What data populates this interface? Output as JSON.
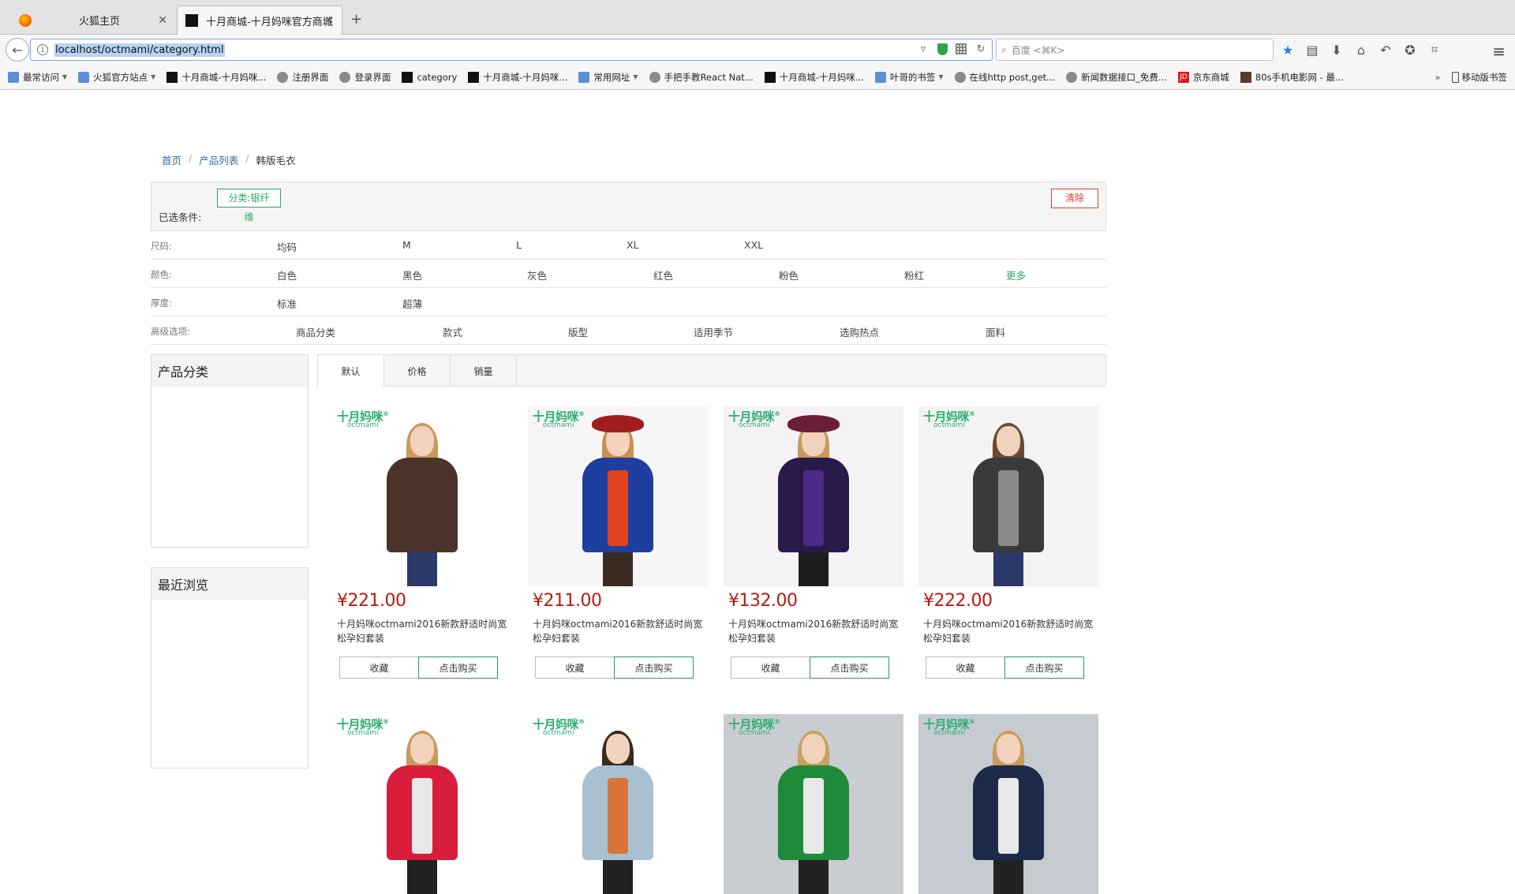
{
  "browser": {
    "tabs": [
      {
        "label": "火狐主页",
        "active": false
      },
      {
        "label": "十月商城-十月妈咪官方商城",
        "active": true
      }
    ],
    "new_tab": "+",
    "url": "localhost/octmami/category.html",
    "search_placeholder": "百度 <⌘K>",
    "bookmarks": [
      {
        "label": "最常访问",
        "icon": "folder-icon",
        "dropdown": true
      },
      {
        "label": "火狐官方站点",
        "icon": "folder-icon",
        "dropdown": true
      },
      {
        "label": "十月商城-十月妈咪...",
        "icon": "page-icon",
        "dropdown": false
      },
      {
        "label": "注册界面",
        "icon": "globe-icon",
        "dropdown": false
      },
      {
        "label": "登录界面",
        "icon": "globe-icon",
        "dropdown": false
      },
      {
        "label": "category",
        "icon": "page-icon",
        "dropdown": false
      },
      {
        "label": "十月商城-十月妈咪...",
        "icon": "page-icon",
        "dropdown": false
      },
      {
        "label": "常用网址",
        "icon": "folder-icon",
        "dropdown": true
      },
      {
        "label": "手把手教React Nat...",
        "icon": "globe-icon",
        "dropdown": false
      },
      {
        "label": "十月商城-十月妈咪...",
        "icon": "page-icon",
        "dropdown": false
      },
      {
        "label": "叶哥的书签",
        "icon": "folder-icon",
        "dropdown": true
      },
      {
        "label": "在线http post,get...",
        "icon": "globe-icon",
        "dropdown": false
      },
      {
        "label": "新闻数据接口_免费...",
        "icon": "globe-icon",
        "dropdown": false
      },
      {
        "label": "京东商城",
        "icon": "jd-icon",
        "dropdown": false
      },
      {
        "label": "80s手机电影网 - 最...",
        "icon": "film-icon",
        "dropdown": false
      }
    ],
    "overflow": "»",
    "mobile_bookmarks": "移动版书签",
    "jd_icon_text": "JD"
  },
  "breadcrumb": {
    "home": "首页",
    "list": "产品列表",
    "current": "韩版毛衣",
    "sep": "/"
  },
  "selected": {
    "label": "已选条件:",
    "chip_line1": "分类:银纤",
    "chip_line2": "维",
    "clear": "清除"
  },
  "filters": [
    {
      "name": "尺码:",
      "options": [
        "均码",
        "M",
        "L",
        "XL",
        "XXL"
      ]
    },
    {
      "name": "颜色:",
      "options": [
        "白色",
        "黑色",
        "灰色",
        "红色",
        "粉色",
        "粉红"
      ],
      "more": "更多"
    },
    {
      "name": "厚度:",
      "options": [
        "标准",
        "超薄"
      ]
    },
    {
      "name": "高级选项:",
      "options": [
        "商品分类",
        "款式",
        "版型",
        "适用季节",
        "选购热点",
        "面料"
      ]
    }
  ],
  "sidebar": {
    "category_title": "产品分类",
    "recent_title": "最近浏览"
  },
  "sort_tabs": [
    "默认",
    "价格",
    "销量"
  ],
  "brand": {
    "cn": "十月妈咪",
    "mark": "®",
    "en": "octmami"
  },
  "product_actions": {
    "favorite": "收藏",
    "buy": "点击购买"
  },
  "products": [
    {
      "price": "¥221.00",
      "title": "十月妈咪octmami2016新款舒适时尚宽松孕妇套装"
    },
    {
      "price": "¥211.00",
      "title": "十月妈咪octmami2016新款舒适时尚宽松孕妇套装"
    },
    {
      "price": "¥132.00",
      "title": "十月妈咪octmami2016新款舒适时尚宽松孕妇套装"
    },
    {
      "price": "¥222.00",
      "title": "十月妈咪octmami2016新款舒适时尚宽松孕妇套装"
    }
  ],
  "colors": {
    "accent_green": "#2ea46a",
    "price_red": "#b31d12",
    "clear_red": "#e23c2f",
    "link_blue": "#2e6ea8"
  }
}
